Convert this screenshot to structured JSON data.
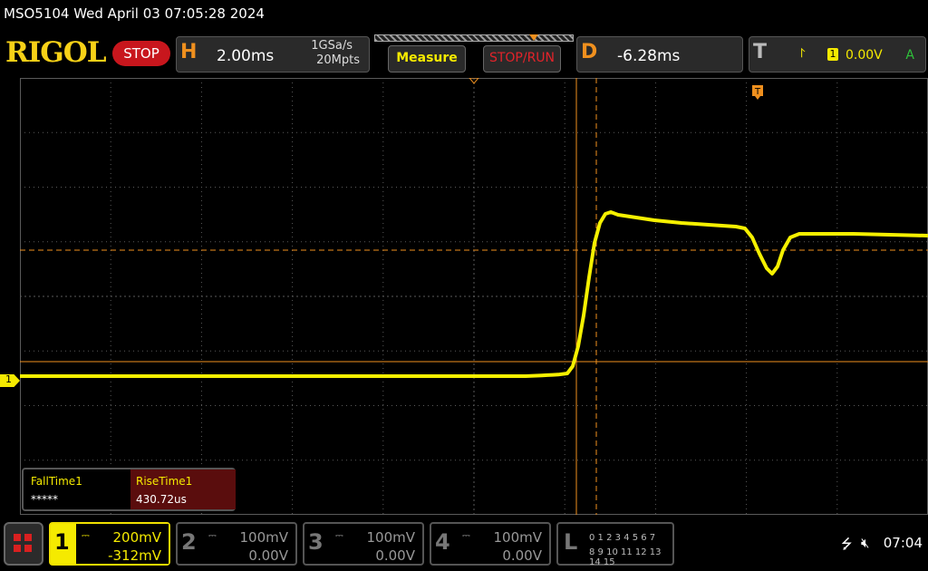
{
  "titlebar": {
    "text": "MSO5104  Wed April 03 07:05:28 2024"
  },
  "topbar": {
    "logo": "RIGOL",
    "run_state": "STOP",
    "horizontal": {
      "letter": "H",
      "timebase": "2.00ms",
      "sample_rate": "1GSa/s",
      "memory_depth": "20Mpts"
    },
    "measure_label": "Measure",
    "stop_run_label": "STOP/RUN",
    "delay": {
      "letter": "D",
      "value": "-6.28ms"
    },
    "trigger": {
      "letter": "T",
      "source": "1",
      "level": "0.00V",
      "mode": "A"
    }
  },
  "screen": {
    "ch1_marker": "1",
    "trace_color": "#f5f000",
    "cursor_color": "#f0901e"
  },
  "measurements": [
    {
      "name": "FallTime1",
      "value": "*****",
      "highlight": false
    },
    {
      "name": "RiseTime1",
      "value": "430.72us",
      "highlight": true
    }
  ],
  "bottombar": {
    "channels": [
      {
        "num": "1",
        "scale": "200mV",
        "offset": "-312mV",
        "active": true
      },
      {
        "num": "2",
        "scale": "100mV",
        "offset": "0.00V",
        "active": false
      },
      {
        "num": "3",
        "scale": "100mV",
        "offset": "0.00V",
        "active": false
      },
      {
        "num": "4",
        "scale": "100mV",
        "offset": "0.00V",
        "active": false
      }
    ],
    "logic": {
      "letter": "L",
      "row1": "0 1 2 3   4 5 6 7",
      "row2": "8 9 10 11  12 13 14 15"
    },
    "usb_icon": "usb-icon",
    "sound_icon": "mute-icon",
    "time": "07:04"
  }
}
